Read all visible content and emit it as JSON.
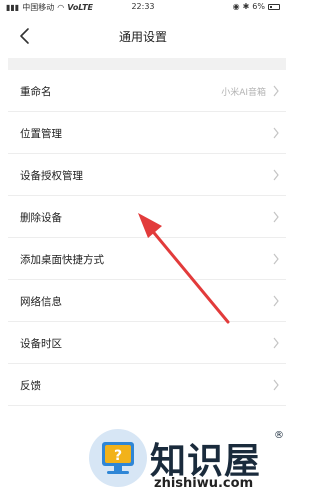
{
  "status": {
    "carrier": "中国移动",
    "network": "VoLTE",
    "time": "22:33",
    "battery": "6%"
  },
  "header": {
    "title": "通用设置"
  },
  "settings": [
    {
      "label": "重命名",
      "value": "小米AI音箱"
    },
    {
      "label": "位置管理",
      "value": ""
    },
    {
      "label": "设备授权管理",
      "value": ""
    },
    {
      "label": "删除设备",
      "value": ""
    },
    {
      "label": "添加桌面快捷方式",
      "value": ""
    },
    {
      "label": "网络信息",
      "value": ""
    },
    {
      "label": "设备时区",
      "value": ""
    },
    {
      "label": "反馈",
      "value": ""
    }
  ],
  "annotation": {
    "color": "#e23b3b"
  },
  "watermark": {
    "name": "知识屋",
    "registered": "®",
    "url": "zhishiwu.com"
  }
}
